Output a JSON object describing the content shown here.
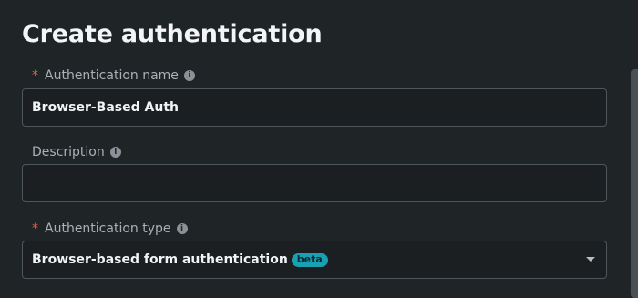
{
  "dialog": {
    "title": "Create authentication"
  },
  "fields": {
    "name": {
      "label": "Authentication name",
      "required_marker": "*",
      "value": "Browser-Based Auth",
      "info_icon": "info-icon"
    },
    "description": {
      "label": "Description",
      "value": "",
      "info_icon": "info-icon"
    },
    "type": {
      "label": "Authentication type",
      "required_marker": "*",
      "value": "Browser-based form authentication",
      "badge": "beta",
      "info_icon": "info-icon",
      "dropdown_icon": "caret-down-icon"
    }
  },
  "colors": {
    "background": "#1f2427",
    "required": "#e8604c",
    "badge": "#1aa0b3",
    "border": "#4f575c"
  }
}
